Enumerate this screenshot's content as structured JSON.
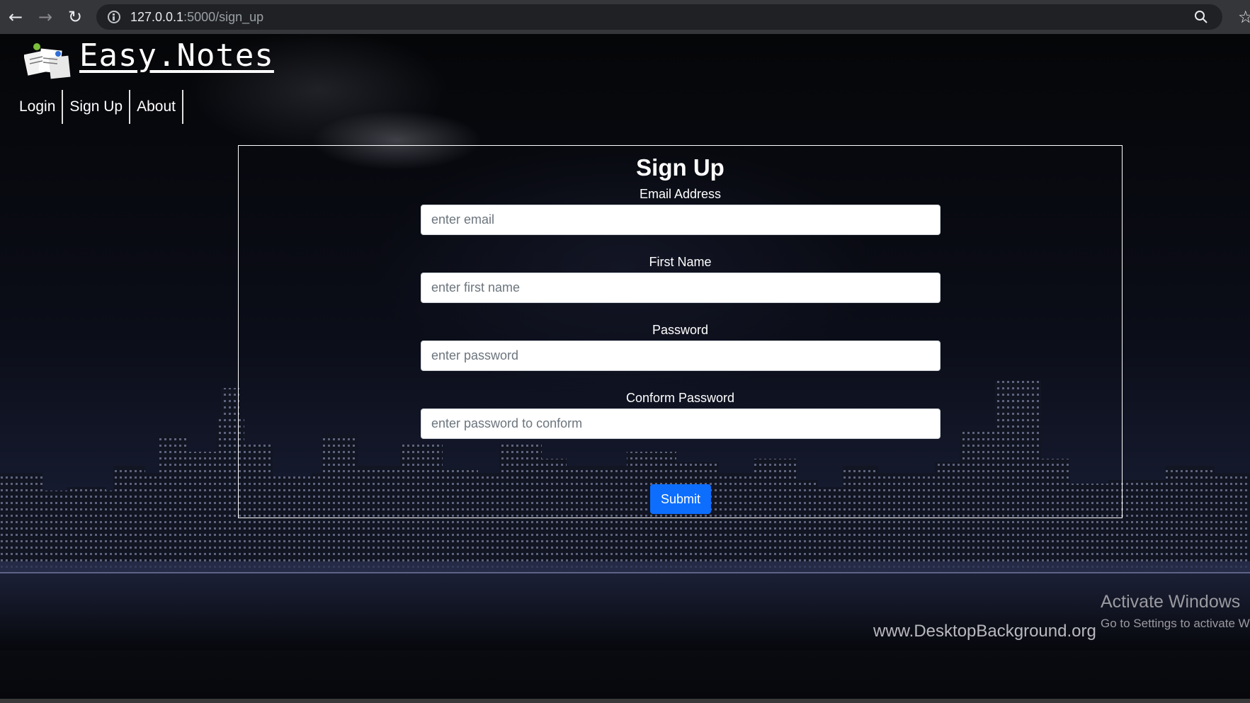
{
  "browser": {
    "url_host": "127.0.0.1",
    "url_path": ":5000/sign_up"
  },
  "icons": {
    "back": "arrow-left-icon",
    "forward": "arrow-right-icon",
    "reload": "reload-icon",
    "site_info": "info-icon",
    "zoom": "magnifier-icon",
    "bookmark": "star-icon",
    "logo": "notes-logo-icon"
  },
  "header": {
    "site_title": "Easy.Notes",
    "nav": [
      "Login",
      "Sign Up",
      "About"
    ]
  },
  "form": {
    "title": "Sign Up",
    "fields": [
      {
        "label": "Email Address",
        "placeholder": "enter email"
      },
      {
        "label": "First Name",
        "placeholder": "enter first name"
      },
      {
        "label": "Password",
        "placeholder": "enter password"
      },
      {
        "label": "Conform Password",
        "placeholder": "enter password to conform"
      }
    ],
    "submit_label": "Submit"
  },
  "background": {
    "watermark": "www.DesktopBackground.org"
  },
  "os_overlay": {
    "activate_title": "Activate Windows",
    "activate_sub": "Go to Settings to activate Windows."
  },
  "colors": {
    "primary_button": "#0d6efd",
    "chrome_bar": "#35363a",
    "omnibox": "#202124"
  }
}
